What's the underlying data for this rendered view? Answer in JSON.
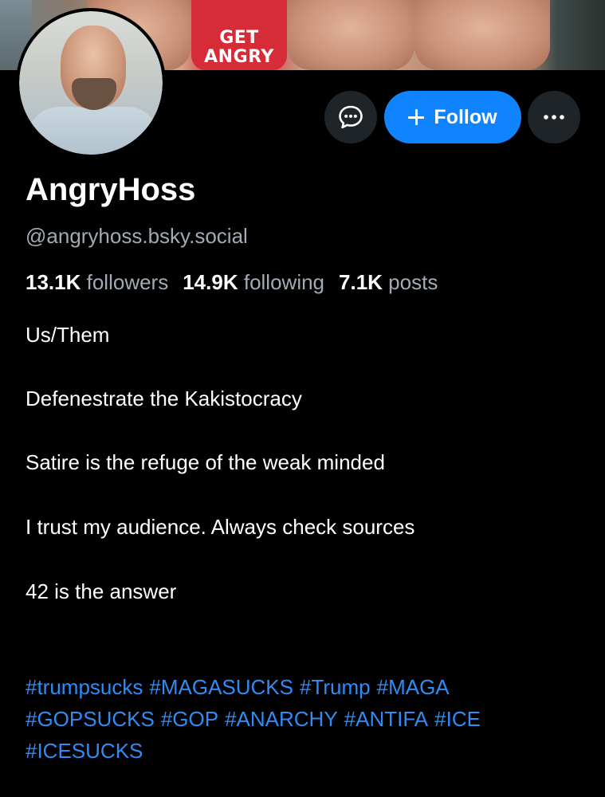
{
  "banner": {
    "shirt_text_line1": "GET",
    "shirt_text_line2": "ANGRY"
  },
  "profile": {
    "display_name": "AngryHoss",
    "handle": "@angryhoss.bsky.social"
  },
  "actions": {
    "message_icon": "chat-bubble-icon",
    "follow_label": "Follow",
    "follow_icon": "plus-icon",
    "more_icon": "ellipsis-icon"
  },
  "stats": [
    {
      "value": "13.1K",
      "label": "followers"
    },
    {
      "value": "14.9K",
      "label": "following"
    },
    {
      "value": "7.1K",
      "label": "posts"
    }
  ],
  "bio": {
    "line1": "Us/Them",
    "line2": "Defenestrate the Kakistocracy",
    "line3": "Satire is the refuge of the weak minded",
    "line4": "I trust my audience.  Always check sources",
    "line5": "42 is the answer"
  },
  "hashtags": {
    "line1": [
      "#trumpsucks",
      "#MAGASUCKS",
      "#Trump",
      "#MAGA"
    ],
    "line2": [
      "#GOPSUCKS",
      "#GOP",
      "#ANARCHY",
      "#ANTIFA",
      "#ICE"
    ],
    "line3": [
      "#ICESUCKS"
    ]
  },
  "colors": {
    "background": "#000000",
    "follow_button": "#1083fe",
    "secondary_text": "#a1aab5",
    "hashtag": "#2f8cf4",
    "circle_button": "#1f2429"
  }
}
